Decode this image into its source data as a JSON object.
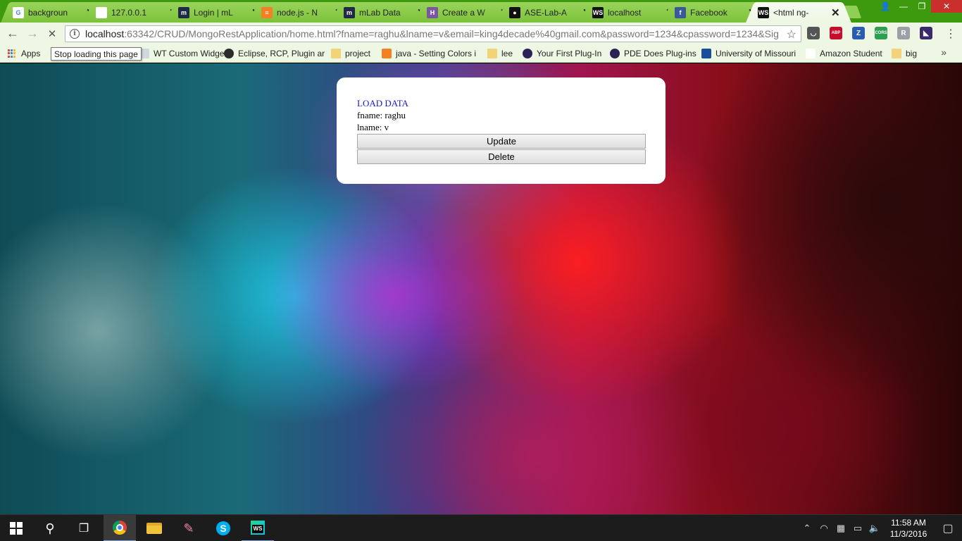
{
  "browser": {
    "tabs": [
      {
        "title": "backgroun",
        "favicon": "google-icon",
        "color": "#ffffff",
        "glyph": "G"
      },
      {
        "title": "127.0.0.1",
        "favicon": "page-icon",
        "color": "#ffffff",
        "glyph": ""
      },
      {
        "title": "Login | mL",
        "favicon": "mlab-icon",
        "color": "#1f2a44",
        "glyph": "m"
      },
      {
        "title": "node.js - N",
        "favicon": "stackoverflow-icon",
        "color": "#f48024",
        "glyph": "≡"
      },
      {
        "title": "mLab Data",
        "favicon": "mlab-icon",
        "color": "#1f2a44",
        "glyph": "m"
      },
      {
        "title": "Create a W",
        "favicon": "heroku-icon",
        "color": "#79589f",
        "glyph": "H"
      },
      {
        "title": "ASE-Lab-A",
        "favicon": "github-icon",
        "color": "#111111",
        "glyph": "●"
      },
      {
        "title": "localhost",
        "favicon": "webstorm-icon",
        "color": "#111111",
        "glyph": "WS"
      },
      {
        "title": "Facebook",
        "favicon": "facebook-icon",
        "color": "#3b5998",
        "glyph": "f"
      },
      {
        "title": "<html ng-",
        "favicon": "webstorm-icon",
        "color": "#111111",
        "glyph": "WS"
      }
    ],
    "close_glyph": "✕",
    "window_buttons": [
      "👤",
      "—",
      "❐",
      "✕"
    ],
    "nav": {
      "back": "←",
      "forward": "→",
      "reload": "✕"
    },
    "url_host": "localhost",
    "url_rest": ":63342/CRUD/MongoRestApplication/home.html?fname=raghu&lname=v&email=king4decade%40gmail.com&password=1234&cpassword=1234&Sig",
    "star": "☆",
    "extensions": [
      {
        "name": "pocket-icon",
        "glyph": "◡",
        "color": "#555555"
      },
      {
        "name": "adblock-icon",
        "glyph": "ABP",
        "color": "#c70d2c"
      },
      {
        "name": "zotero-icon",
        "glyph": "Z",
        "color": "#2a5db0"
      },
      {
        "name": "cors-icon",
        "glyph": "CORS",
        "color": "#2e9e4f"
      },
      {
        "name": "ext-icon",
        "glyph": "R",
        "color": "#9aa0a6"
      },
      {
        "name": "ext-icon-2",
        "glyph": "◣",
        "color": "#3a2a6a"
      }
    ],
    "menu": "⋮",
    "bookmarks": [
      {
        "label": "Apps",
        "kind": "apps"
      },
      {
        "label": "WT Custom Widgets",
        "kind": "page"
      },
      {
        "label": "Eclipse, RCP, Plugin ar",
        "kind": "eclipse"
      },
      {
        "label": "project",
        "kind": "folder"
      },
      {
        "label": "java - Setting Colors i",
        "kind": "so"
      },
      {
        "label": "lee",
        "kind": "folder"
      },
      {
        "label": "Your First Plug-In",
        "kind": "eclipse2"
      },
      {
        "label": "PDE Does Plug-ins",
        "kind": "eclipse2"
      },
      {
        "label": "University of Missouri",
        "kind": "umkc"
      },
      {
        "label": "Amazon Student",
        "kind": "amazon"
      },
      {
        "label": "big",
        "kind": "folder"
      }
    ],
    "bookmarks_more": "»",
    "tooltip": "Stop loading this page"
  },
  "page": {
    "load_link": "LOAD DATA",
    "fname_line": "fname: raghu",
    "lname_line": "lname: v",
    "update_label": "Update",
    "delete_label": "Delete"
  },
  "taskbar": {
    "search_glyph": "⚲",
    "taskview_glyph": "❐",
    "paint_glyph": "✎",
    "skype_glyph": "S",
    "webstorm_glyph": "WS",
    "tray": [
      "⌃",
      "◠",
      "▦",
      "▭",
      "🔈"
    ],
    "time": "11:58 AM",
    "date": "11/3/2016",
    "notification": "▢"
  }
}
